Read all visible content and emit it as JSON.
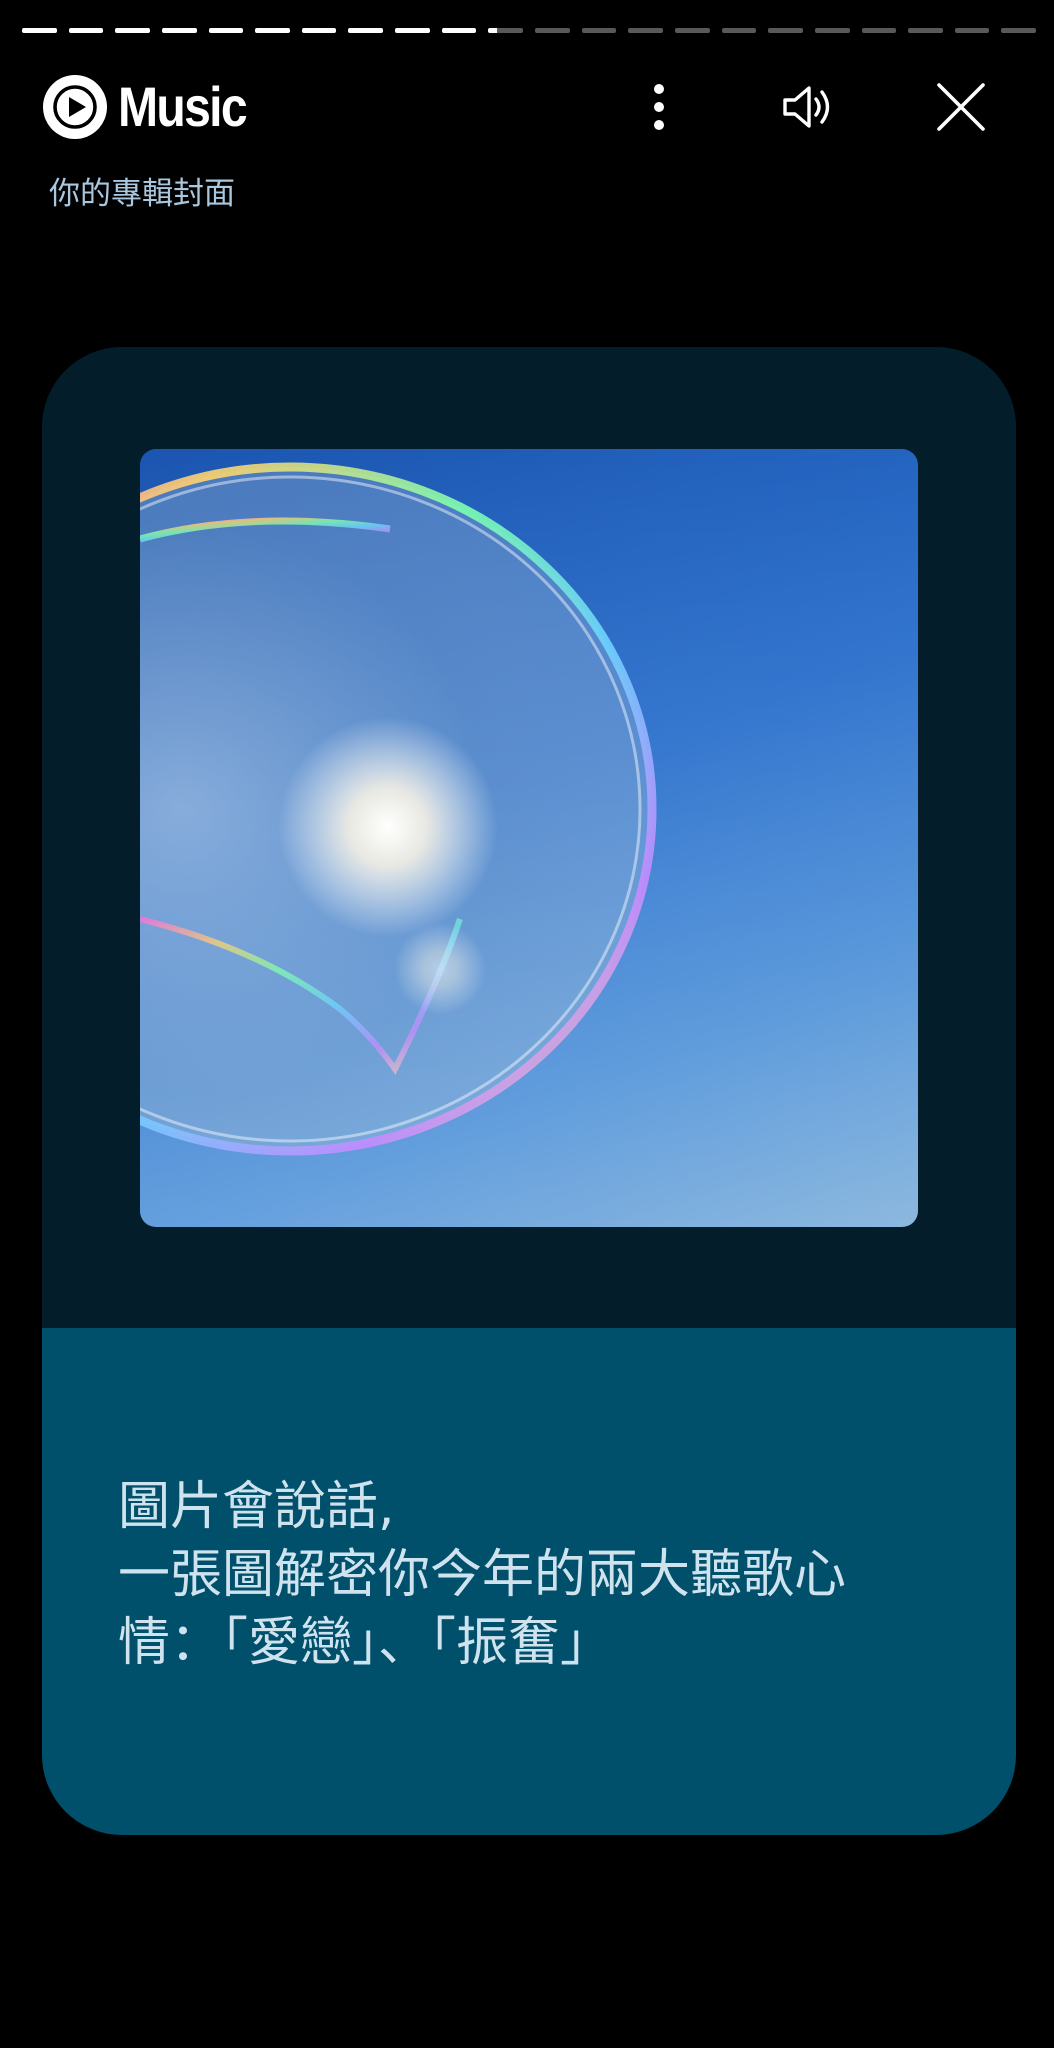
{
  "progress": {
    "segments": 22,
    "completed": 10,
    "current_fraction": 0.25
  },
  "header": {
    "logo_icon": "youtube-music-play-icon",
    "app_name": "Music",
    "more_icon": "more-vert-icon",
    "sound_icon": "volume-on-icon",
    "close_icon": "close-icon"
  },
  "subtitle": "你的專輯封面",
  "card": {
    "cover_image": "soap-bubble-against-blue-sky",
    "caption_lines": [
      "圖片會說話,",
      "一張圖解密你今年的兩大聽歌心",
      "情：「愛戀」、「振奮」"
    ]
  },
  "colors": {
    "background": "#000000",
    "card_top": "#031d2a",
    "card_bottom": "#004f6b",
    "subtitle_text": "#a9c7de",
    "caption_text": "#cfe3ef"
  }
}
